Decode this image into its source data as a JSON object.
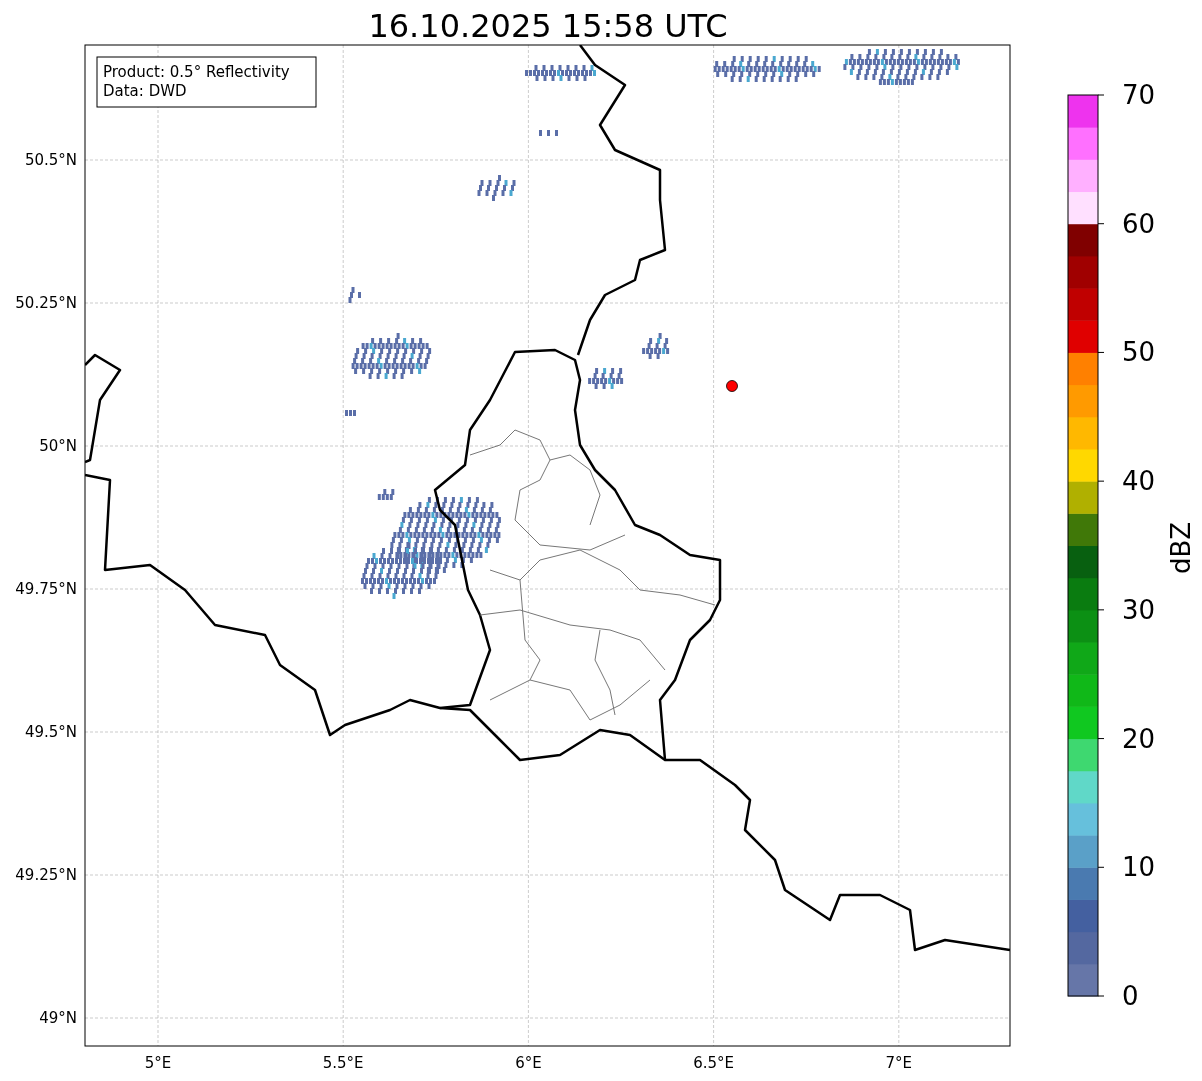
{
  "title": "16.10.2025 15:58 UTC",
  "info_box": {
    "lines": [
      "Product: 0.5° Reflectivity",
      "Data: DWD"
    ]
  },
  "map": {
    "lat_labels": [
      "50.5°N",
      "50.25°N",
      "50°N",
      "49.75°N",
      "49.5°N",
      "49.25°N",
      "49°N"
    ],
    "lon_labels": [
      "5°E",
      "5.5°E",
      "6°E",
      "6.5°E",
      "7°E"
    ]
  },
  "colorbar": {
    "label": "dBZ",
    "tick_labels": [
      "70",
      "60",
      "50",
      "40",
      "30",
      "20",
      "10",
      "0"
    ],
    "bands": [
      {
        "color": "#6676a8"
      },
      {
        "color": "#5468a0"
      },
      {
        "color": "#4460a0"
      },
      {
        "color": "#4a7ab0"
      },
      {
        "color": "#5aa0c8"
      },
      {
        "color": "#66c0dc"
      },
      {
        "color": "#60d8c8"
      },
      {
        "color": "#3ed870"
      },
      {
        "color": "#10c820"
      },
      {
        "color": "#10b818"
      },
      {
        "color": "#10a818"
      },
      {
        "color": "#0c9014"
      },
      {
        "color": "#0a7c10"
      },
      {
        "color": "#086010"
      },
      {
        "color": "#407808"
      },
      {
        "color": "#b0b000"
      },
      {
        "color": "#ffd800"
      },
      {
        "color": "#ffb800"
      },
      {
        "color": "#ff9a00"
      },
      {
        "color": "#ff8000"
      },
      {
        "color": "#e00000"
      },
      {
        "color": "#c00000"
      },
      {
        "color": "#a00000"
      },
      {
        "color": "#800000"
      },
      {
        "color": "#ffe0ff"
      },
      {
        "color": "#ffb0ff"
      },
      {
        "color": "#ff70ff"
      },
      {
        "color": "#ee33ee"
      }
    ]
  }
}
